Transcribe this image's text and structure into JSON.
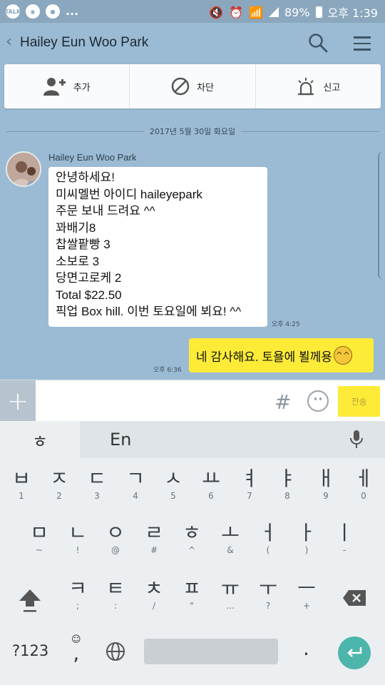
{
  "status_bar": {
    "left_icons": [
      "talk-icon",
      "messenger-icon",
      "chat-icon"
    ],
    "overflow": "...",
    "battery": "89%",
    "time": "오후 1:39"
  },
  "header": {
    "title": "Hailey Eun Woo Park"
  },
  "actions": [
    {
      "label": "추가",
      "icon": "add-friend-icon"
    },
    {
      "label": "차단",
      "icon": "block-icon"
    },
    {
      "label": "신고",
      "icon": "report-siren-icon"
    }
  ],
  "date_divider": "2017년 5월 30일 화요일",
  "messages": {
    "incoming": {
      "sender": "Hailey Eun Woo Park",
      "lines": [
        "안녕하세요!",
        "미씨멜번 아이디 haileyepark",
        "주문 보내 드려요 ^^",
        "꽈배기8",
        "찹쌀팥빵 3",
        "소보로 3",
        "당면고로케 2",
        "Total $22.50",
        "픽업 Box hill. 이번 토요일에 뵈요! ^^"
      ],
      "time": "오후 4:25"
    },
    "outgoing": {
      "text": "네 감사해요. 토욜에 뵐께용",
      "emoticon": "^^",
      "time": "오후 6:36"
    }
  },
  "input_bar": {
    "plus": "+",
    "hash": "#",
    "send_label": "전송"
  },
  "keyboard": {
    "lang_korean": "ㅎ",
    "lang_english": "En",
    "row1": [
      {
        "main": "ㅂ",
        "sub": "1"
      },
      {
        "main": "ㅈ",
        "sub": "2"
      },
      {
        "main": "ㄷ",
        "sub": "3"
      },
      {
        "main": "ㄱ",
        "sub": "4"
      },
      {
        "main": "ㅅ",
        "sub": "5"
      },
      {
        "main": "ㅛ",
        "sub": "6"
      },
      {
        "main": "ㅕ",
        "sub": "7"
      },
      {
        "main": "ㅑ",
        "sub": "8"
      },
      {
        "main": "ㅐ",
        "sub": "9"
      },
      {
        "main": "ㅔ",
        "sub": "0"
      }
    ],
    "row2": [
      {
        "main": "ㅁ",
        "sub": "~"
      },
      {
        "main": "ㄴ",
        "sub": "!"
      },
      {
        "main": "ㅇ",
        "sub": "@"
      },
      {
        "main": "ㄹ",
        "sub": "#"
      },
      {
        "main": "ㅎ",
        "sub": "^"
      },
      {
        "main": "ㅗ",
        "sub": "&"
      },
      {
        "main": "ㅓ",
        "sub": "("
      },
      {
        "main": "ㅏ",
        "sub": ")"
      },
      {
        "main": "ㅣ",
        "sub": "-"
      }
    ],
    "row3": [
      {
        "main": "ㅋ",
        "sub": ";"
      },
      {
        "main": "ㅌ",
        "sub": ":"
      },
      {
        "main": "ㅊ",
        "sub": "/"
      },
      {
        "main": "ㅍ",
        "sub": "\""
      },
      {
        "main": "ㅠ",
        "sub": "..."
      },
      {
        "main": "ㅜ",
        "sub": "?"
      },
      {
        "main": "ㅡ",
        "sub": "+"
      }
    ],
    "symbols_label": "?123",
    "comma_sub": "☺",
    "comma": ",",
    "period": "."
  },
  "colors": {
    "chat_bg": "#9bbbd4",
    "outgoing_bubble": "#fdeb37",
    "enter_key": "#4db6ac"
  }
}
